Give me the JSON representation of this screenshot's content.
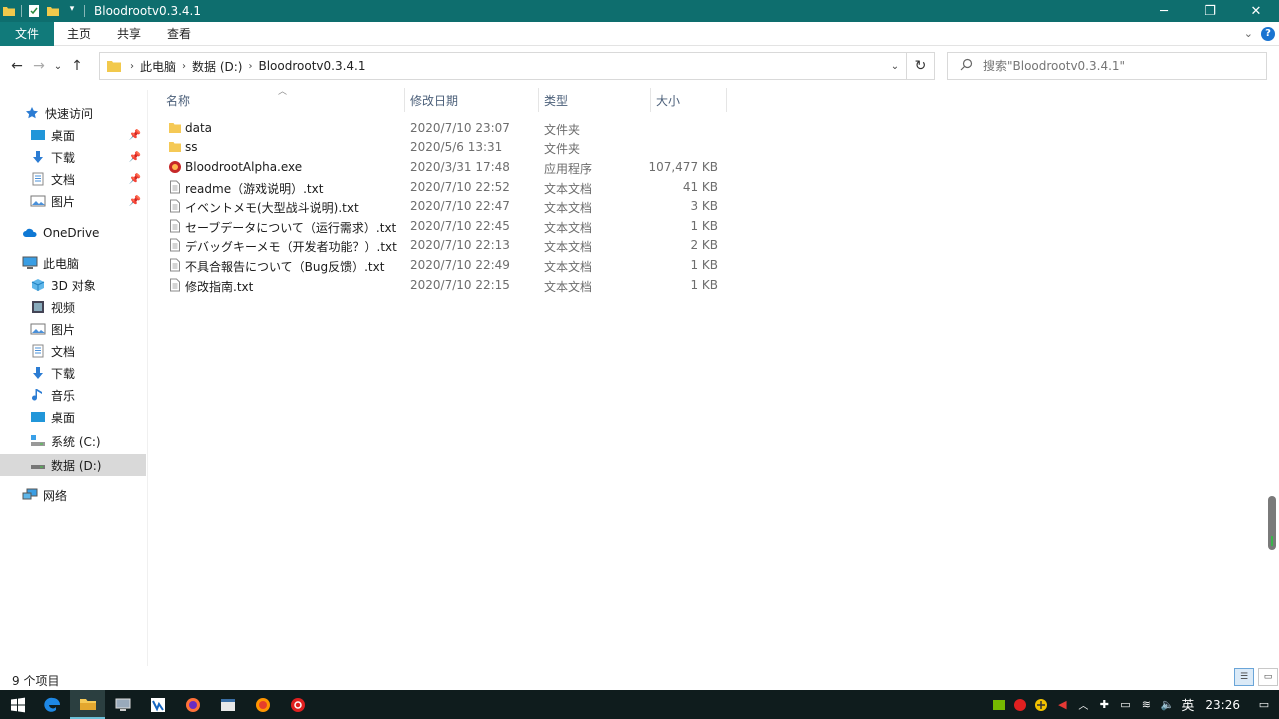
{
  "window": {
    "title": "Bloodrootv0.3.4.1",
    "controls": {
      "minimize": "─",
      "restore": "❐",
      "close": "✕"
    }
  },
  "ribbon": {
    "tabs": [
      "文件",
      "主页",
      "共享",
      "查看"
    ]
  },
  "address": {
    "back": "←",
    "forward": "→",
    "recent": "⌄",
    "up": "↑",
    "breadcrumb": [
      "此电脑",
      "数据 (D:)",
      "Bloodrootv0.3.4.1"
    ],
    "refresh": "↻",
    "search_placeholder": "搜索\"Bloodrootv0.3.4.1\""
  },
  "sidebar": {
    "items": [
      {
        "label": "快速访问",
        "icon": "star-icon"
      },
      {
        "label": "桌面",
        "icon": "desktop-icon",
        "pinned": true
      },
      {
        "label": "下载",
        "icon": "download-icon",
        "pinned": true
      },
      {
        "label": "文档",
        "icon": "document-icon",
        "pinned": true
      },
      {
        "label": "图片",
        "icon": "picture-icon",
        "pinned": true
      },
      {
        "label": "OneDrive",
        "icon": "cloud-icon"
      },
      {
        "label": "此电脑",
        "icon": "computer-icon"
      },
      {
        "label": "3D 对象",
        "icon": "cube-icon"
      },
      {
        "label": "视频",
        "icon": "video-icon"
      },
      {
        "label": "图片",
        "icon": "picture-icon"
      },
      {
        "label": "文档",
        "icon": "document-icon"
      },
      {
        "label": "下载",
        "icon": "download-icon"
      },
      {
        "label": "音乐",
        "icon": "music-icon"
      },
      {
        "label": "桌面",
        "icon": "desktop-icon"
      },
      {
        "label": "系统 (C:)",
        "icon": "drive-c-icon"
      },
      {
        "label": "数据 (D:)",
        "icon": "drive-icon",
        "selected": true
      },
      {
        "label": "网络",
        "icon": "network-icon"
      }
    ]
  },
  "filelist": {
    "columns": [
      "名称",
      "修改日期",
      "类型",
      "大小"
    ],
    "rows": [
      {
        "name": "data",
        "date": "2020/7/10 23:07",
        "type": "文件夹",
        "size": "",
        "icon": "folder-icon"
      },
      {
        "name": "ss",
        "date": "2020/5/6 13:31",
        "type": "文件夹",
        "size": "",
        "icon": "folder-icon"
      },
      {
        "name": "BloodrootAlpha.exe",
        "date": "2020/3/31 17:48",
        "type": "应用程序",
        "size": "107,477 KB",
        "icon": "exe-icon"
      },
      {
        "name": "readme（游戏说明）.txt",
        "date": "2020/7/10 22:52",
        "type": "文本文档",
        "size": "41 KB",
        "icon": "text-file-icon"
      },
      {
        "name": "イベントメモ(大型战斗说明).txt",
        "date": "2020/7/10 22:47",
        "type": "文本文档",
        "size": "3 KB",
        "icon": "text-file-icon"
      },
      {
        "name": "セーブデータについて（运行需求）.txt",
        "date": "2020/7/10 22:45",
        "type": "文本文档",
        "size": "1 KB",
        "icon": "text-file-icon"
      },
      {
        "name": "デバッグキーメモ（开发者功能？）.txt",
        "date": "2020/7/10 22:13",
        "type": "文本文档",
        "size": "2 KB",
        "icon": "text-file-icon"
      },
      {
        "name": "不具合報告について（Bug反馈）.txt",
        "date": "2020/7/10 22:49",
        "type": "文本文档",
        "size": "1 KB",
        "icon": "text-file-icon"
      },
      {
        "name": "修改指南.txt",
        "date": "2020/7/10 22:15",
        "type": "文本文档",
        "size": "1 KB",
        "icon": "text-file-icon"
      }
    ]
  },
  "status": {
    "count": "9 个项目"
  },
  "taskbar": {
    "clock": "23:26",
    "ime": "英"
  },
  "colors": {
    "titlebar": "#0e6e6e",
    "file_tab": "#117a7a",
    "selected": "#d9d9d9",
    "taskbar": "#0f1c1d"
  }
}
